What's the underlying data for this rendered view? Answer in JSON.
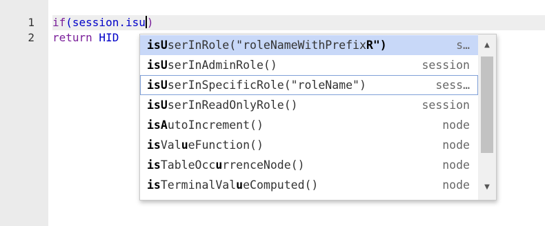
{
  "gutter": {
    "line_numbers": [
      "1",
      "2"
    ]
  },
  "code": {
    "line1": {
      "keyword": "if",
      "rest": "(session.isu",
      "after_cursor": ")"
    },
    "line2": {
      "keyword": "return",
      "rest": " HID"
    }
  },
  "autocomplete": {
    "items": [
      {
        "bold": "isU",
        "mid1": "serInRole(\"roleNameWithPrefix",
        "bold2": "R\")",
        "rest": "",
        "meta": "s…"
      },
      {
        "bold": "isU",
        "rest": "serInAdminRole()",
        "meta": "session"
      },
      {
        "bold": "isU",
        "rest": "serInSpecificRole(\"roleName\")",
        "meta": "sess…"
      },
      {
        "bold": "isU",
        "rest": "serInReadOnlyRole()",
        "meta": "session"
      },
      {
        "bold": "isA",
        "rest": "utoIncrement()",
        "meta": "node"
      },
      {
        "bold": "is",
        "mid1": "Val",
        "bold2": "u",
        "rest": "eFunction()",
        "meta": "node"
      },
      {
        "bold": "is",
        "mid1": "TableOcc",
        "bold2": "u",
        "rest": "rrenceNode()",
        "meta": "node"
      },
      {
        "bold": "is",
        "mid1": "TerminalVal",
        "bold2": "u",
        "rest": "eComputed()",
        "meta": "node"
      }
    ],
    "scroll_up_icon": "triangle-up",
    "scroll_down_icon": "triangle-down"
  },
  "colors": {
    "keyword": "#7a1f9a",
    "identifier": "#0000c8",
    "selected_item_bg": "#c8d8f8",
    "gutter_bg": "#ebebeb"
  }
}
